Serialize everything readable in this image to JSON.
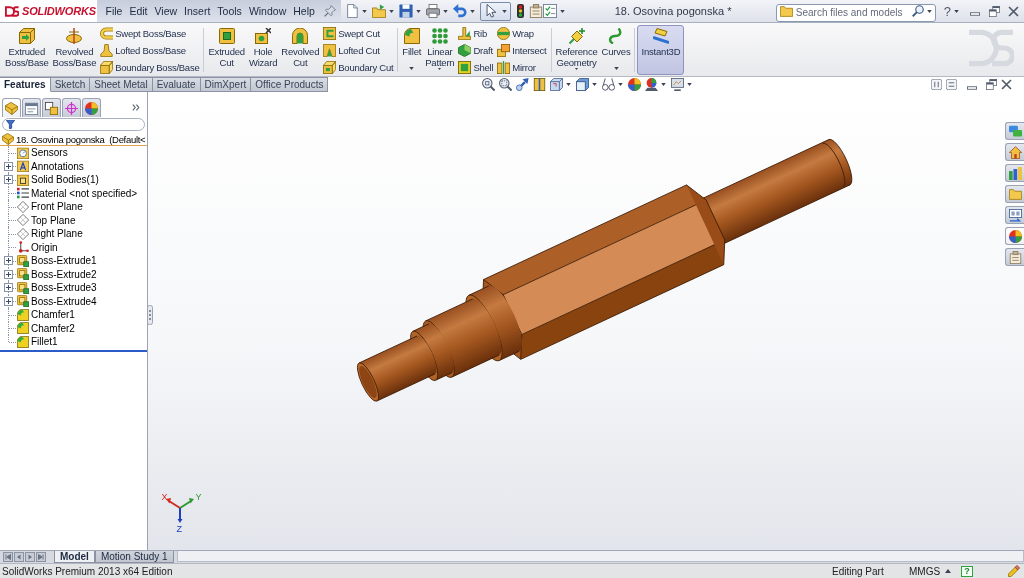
{
  "title_bar": {
    "logo_text": "SOLIDWORKS",
    "menus": [
      "File",
      "Edit",
      "View",
      "Insert",
      "Tools",
      "Window",
      "Help"
    ],
    "document_title": "18. Osovina pogonska *",
    "search": {
      "placeholder": "Search files and models"
    },
    "help_symbol": "?"
  },
  "ribbon": {
    "groups": [
      {
        "large_buttons": [
          {
            "label": "Extruded Boss/Base",
            "dropdown": false,
            "on": false
          },
          {
            "label": "Revolved Boss/Base",
            "dropdown": false,
            "on": false
          }
        ],
        "small_stacks": [
          [
            "Swept Boss/Base",
            "Lofted Boss/Base",
            "Boundary Boss/Base"
          ]
        ]
      },
      {
        "large_buttons": [
          {
            "label": "Extruded Cut",
            "dropdown": false,
            "on": false
          },
          {
            "label": "Hole Wizard",
            "dropdown": false,
            "on": false
          },
          {
            "label": "Revolved Cut",
            "dropdown": false,
            "on": false
          }
        ],
        "small_stacks": [
          [
            "Swept Cut",
            "Lofted Cut",
            "Boundary Cut"
          ]
        ]
      },
      {
        "large_buttons": [
          {
            "label": "Fillet",
            "dropdown": true,
            "on": false
          },
          {
            "label": "Linear Pattern",
            "dropdown": true,
            "on": false
          }
        ],
        "small_stacks": [
          [
            "Rib",
            "Draft",
            "Shell"
          ],
          [
            "Wrap",
            "Intersect",
            "Mirror"
          ]
        ]
      },
      {
        "large_buttons": [
          {
            "label": "Reference Geometry",
            "dropdown": true,
            "on": false
          },
          {
            "label": "Curves",
            "dropdown": true,
            "on": false
          }
        ]
      },
      {
        "large_buttons": [
          {
            "label": "Instant3D",
            "dropdown": false,
            "on": true
          }
        ]
      }
    ]
  },
  "command_tabs": [
    {
      "label": "Features",
      "selected": true
    },
    {
      "label": "Sketch",
      "selected": false
    },
    {
      "label": "Sheet Metal",
      "selected": false
    },
    {
      "label": "Evaluate",
      "selected": false
    },
    {
      "label": "DimXpert",
      "selected": false
    },
    {
      "label": "Office Products",
      "selected": false
    }
  ],
  "feature_manager": {
    "panel_tabs": [
      {
        "kind": "feature-tree",
        "selected": true
      },
      {
        "kind": "properties",
        "selected": false
      },
      {
        "kind": "configurations",
        "selected": false
      },
      {
        "kind": "dimxpert",
        "selected": false
      },
      {
        "kind": "display",
        "selected": false
      }
    ],
    "root": "18. Osovina pogonska  (Default<",
    "items": [
      {
        "label": "Sensors",
        "kind": "sensors",
        "expandable": false
      },
      {
        "label": "Annotations",
        "kind": "annotations",
        "expandable": true
      },
      {
        "label": "Solid Bodies(1)",
        "kind": "solid-bodies",
        "expandable": true
      },
      {
        "label": "Material <not specified>",
        "kind": "material",
        "expandable": false
      },
      {
        "label": "Front Plane",
        "kind": "plane",
        "expandable": false
      },
      {
        "label": "Top Plane",
        "kind": "plane",
        "expandable": false
      },
      {
        "label": "Right Plane",
        "kind": "plane",
        "expandable": false
      },
      {
        "label": "Origin",
        "kind": "origin",
        "expandable": false
      },
      {
        "label": "Boss-Extrude1",
        "kind": "extrude",
        "expandable": true
      },
      {
        "label": "Boss-Extrude2",
        "kind": "extrude",
        "expandable": true
      },
      {
        "label": "Boss-Extrude3",
        "kind": "extrude",
        "expandable": true
      },
      {
        "label": "Boss-Extrude4",
        "kind": "extrude",
        "expandable": true
      },
      {
        "label": "Chamfer1",
        "kind": "chamfer",
        "expandable": false
      },
      {
        "label": "Chamfer2",
        "kind": "chamfer",
        "expandable": false
      },
      {
        "label": "Fillet1",
        "kind": "fillet",
        "expandable": false
      }
    ]
  },
  "viewport": {
    "triad": [
      {
        "label": "X",
        "color": "#d42a20"
      },
      {
        "label": "Y",
        "color": "#2f9a2f"
      },
      {
        "label": "Z",
        "color": "#2040c0"
      }
    ]
  },
  "bottom_tabs": [
    {
      "label": "Model",
      "selected": true
    },
    {
      "label": "Motion Study 1",
      "selected": false
    }
  ],
  "status_bar": {
    "edition": "SolidWorks Premium 2013 x64 Edition",
    "mode": "Editing Part",
    "units": "MMGS",
    "quick_tips": "?"
  }
}
